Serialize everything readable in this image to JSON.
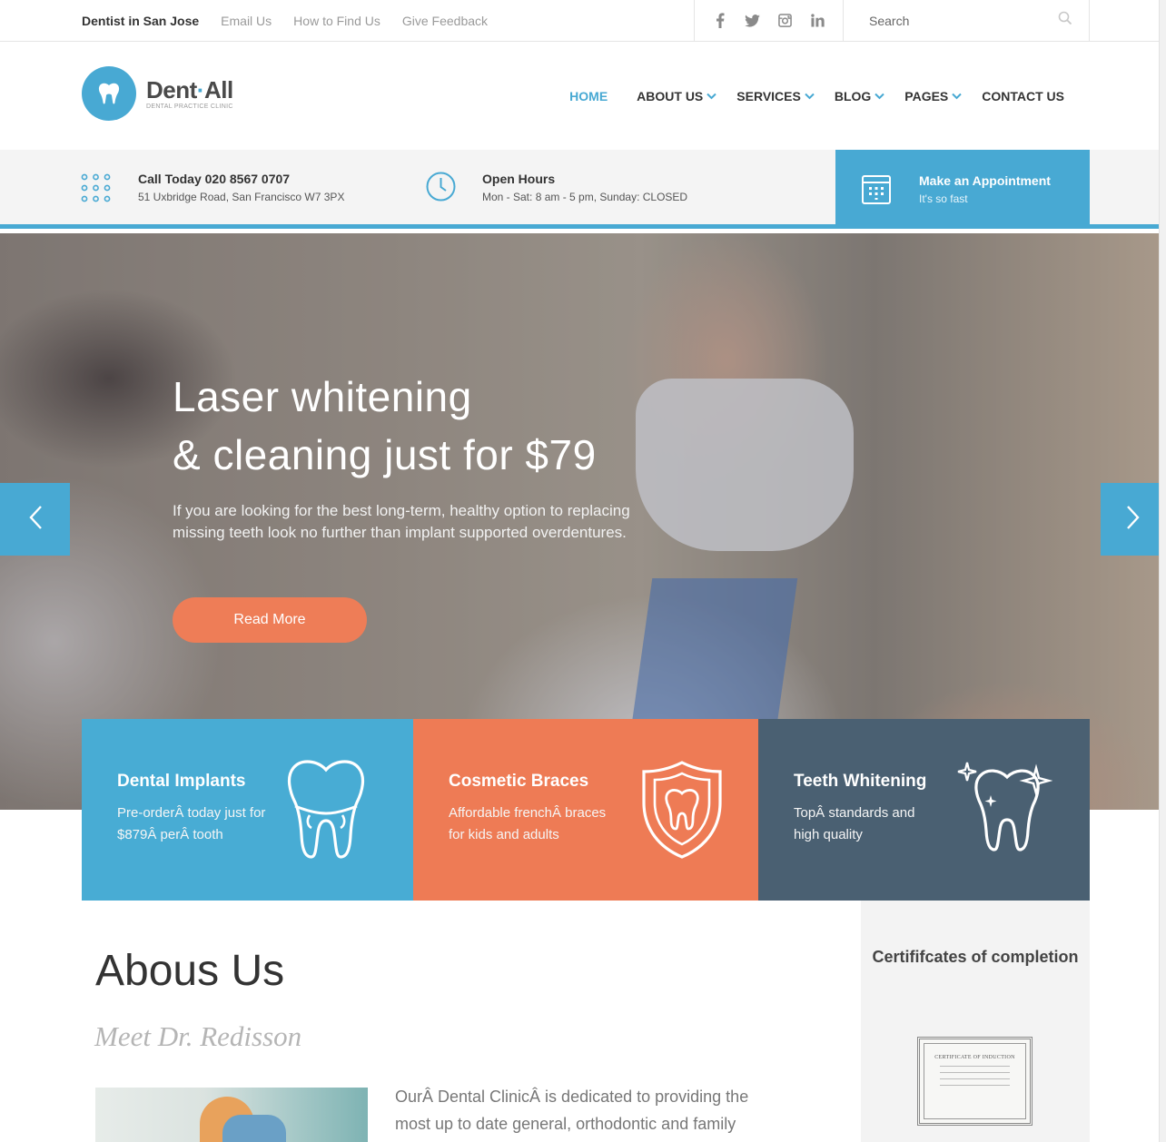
{
  "topbar": {
    "location": "Dentist in San Jose",
    "links": [
      "Email Us",
      "How to Find Us",
      "Give Feedback"
    ],
    "social": [
      "facebook-icon",
      "twitter-icon",
      "instagram-icon",
      "linkedin-icon"
    ],
    "search_placeholder": "Search"
  },
  "logo": {
    "name_part1": "Dent",
    "name_dot": "·",
    "name_part2": "All",
    "tagline": "DENTAL PRACTICE CLINIC"
  },
  "nav": {
    "items": [
      {
        "label": "HOME",
        "active": true,
        "dropdown": false
      },
      {
        "label": "ABOUT US",
        "dropdown": true
      },
      {
        "label": "SERVICES",
        "dropdown": true
      },
      {
        "label": "BLOG",
        "dropdown": true
      },
      {
        "label": "PAGES",
        "dropdown": true
      },
      {
        "label": "CONTACT US",
        "dropdown": false
      }
    ]
  },
  "info": {
    "call_title": "Call Today 020 8567 0707",
    "call_sub": "51 Uxbridge Road, San Francisco W7 3PX",
    "hours_title": "Open Hours",
    "hours_sub": "Mon - Sat: 8 am - 5 pm, Sunday: CLOSED",
    "appt_title": "Make an Appointment",
    "appt_sub": "It's so fast"
  },
  "hero": {
    "headline_1": "Laser whitening",
    "headline_2": "& cleaning just for $79",
    "text": "If you are looking for the best long-term, healthy option to replacing missing teeth look no further than implant supported overdentures.",
    "button": "Read More"
  },
  "features": [
    {
      "title": "Dental Implants",
      "desc": "Pre-orderÂ today just for $879Â perÂ tooth",
      "color": "#48acd4",
      "icon": "tooth-icon"
    },
    {
      "title": "Cosmetic Braces",
      "desc": "Affordable frenchÂ braces for kids and adults",
      "color": "#ee7b55",
      "icon": "shield-tooth-icon"
    },
    {
      "title": "Teeth Whitening",
      "desc": "TopÂ standards and high quality",
      "color": "#4a6072",
      "icon": "sparkle-tooth-icon"
    }
  ],
  "about": {
    "title": "Abous Us",
    "subtitle": "Meet Dr. Redisson",
    "text": "OurÂ Dental ClinicÂ is dedicated to providing the most up to date general, orthodontic and family"
  },
  "certificate": {
    "title": "Certififcates of completion",
    "paper_title": "CERTIFICATE OF INDUCTION"
  },
  "colors": {
    "accent": "#48a9d3",
    "orange": "#ee7d57",
    "slate": "#4a6072"
  }
}
